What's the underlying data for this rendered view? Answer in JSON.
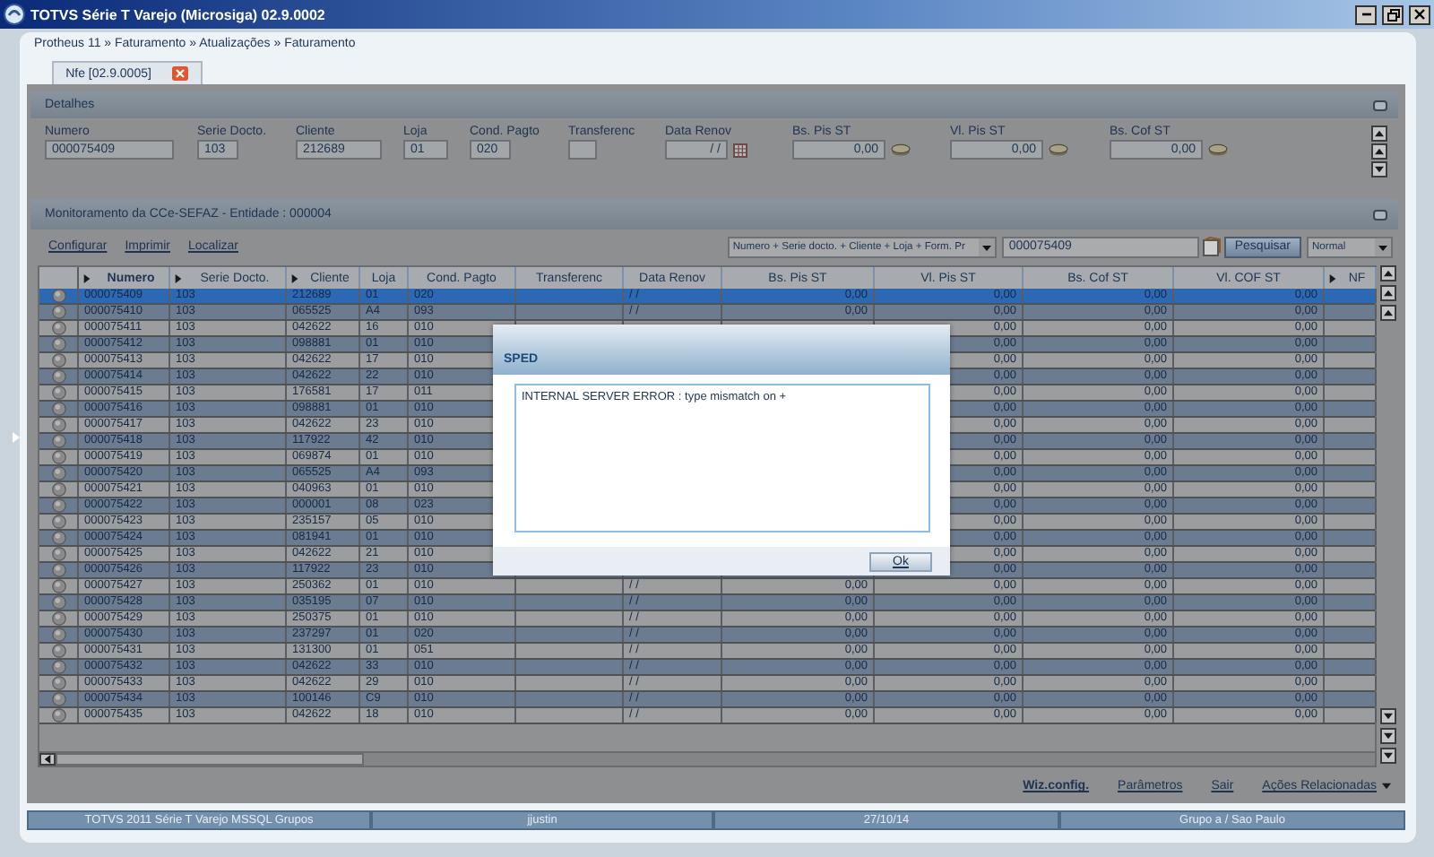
{
  "window": {
    "title": "TOTVS Série T Varejo (Microsiga) 02.9.0002"
  },
  "breadcrumb": "Protheus 11 » Faturamento » Atualizações » Faturamento",
  "tabs": [
    {
      "label": "Nfe [02.9.0005]",
      "selected": true
    }
  ],
  "details": {
    "title": "Detalhes",
    "fields": [
      {
        "label": "Numero",
        "value": "000075409",
        "kind": "text"
      },
      {
        "label": "Serie Docto.",
        "value": "103",
        "kind": "text"
      },
      {
        "label": "Cliente",
        "value": "212689",
        "kind": "text"
      },
      {
        "label": "Loja",
        "value": "01",
        "kind": "text"
      },
      {
        "label": "Cond. Pagto",
        "value": "020",
        "kind": "text"
      },
      {
        "label": "Transferenc",
        "kind": "text"
      },
      {
        "label": "Data Renov",
        "value": " / /",
        "kind": "date"
      },
      {
        "label": "Bs. Pis ST",
        "value": "0,00",
        "kind": "money"
      },
      {
        "label": "Vl. Pis ST",
        "value": "0,00",
        "kind": "money"
      },
      {
        "label": "Bs. Cof ST",
        "value": "0,00",
        "kind": "money"
      }
    ]
  },
  "monitor": {
    "title": "Monitoramento da CCe-SEFAZ - Entidade : 000004",
    "links": [
      "Configurar",
      "Imprimir",
      "Localizar"
    ],
    "order_select": "Numero + Serie docto. + Cliente + Loja + Form. Pr",
    "search_value": "000075409",
    "search_button": "Pesquisar",
    "mode_select": "Normal"
  },
  "table": {
    "columns": [
      {
        "label": "Numero",
        "arrow": true,
        "sorted": true
      },
      {
        "label": "Serie Docto.",
        "arrow": true,
        "sorted": false
      },
      {
        "label": "Cliente",
        "arrow": true,
        "sorted": false
      },
      {
        "label": "Loja",
        "arrow": false,
        "sorted": false
      },
      {
        "label": "Cond. Pagto",
        "arrow": false,
        "sorted": false
      },
      {
        "label": "Transferenc",
        "arrow": false,
        "sorted": false
      },
      {
        "label": "Data Renov",
        "arrow": false,
        "sorted": false
      },
      {
        "label": "Bs. Pis ST",
        "arrow": false,
        "sorted": false
      },
      {
        "label": "Vl. Pis ST",
        "arrow": false,
        "sorted": false
      },
      {
        "label": "Bs. Cof ST",
        "arrow": false,
        "sorted": false
      },
      {
        "label": "Vl. COF ST",
        "arrow": false,
        "sorted": false
      },
      {
        "label": "NF",
        "arrow": true,
        "sorted": false
      }
    ],
    "rows": [
      {
        "selected": true,
        "numero": "000075409",
        "serie": "103",
        "cliente": "212689",
        "loja": "01",
        "cond": "020",
        "data": "/ /",
        "bs_pis": "0,00",
        "vl_pis": "0,00",
        "bs_cof": "0,00",
        "vl_cof": "0,00"
      },
      {
        "selected": false,
        "numero": "000075410",
        "serie": "103",
        "cliente": "065525",
        "loja": "A4",
        "cond": "093",
        "data": "/ /",
        "bs_pis": "0,00",
        "vl_pis": "0,00",
        "bs_cof": "0,00",
        "vl_cof": "0,00"
      },
      {
        "selected": false,
        "numero": "000075411",
        "serie": "103",
        "cliente": "042622",
        "loja": "16",
        "cond": "010",
        "vl_pis": "0,00",
        "bs_cof": "0,00",
        "vl_cof": "0,00"
      },
      {
        "selected": false,
        "numero": "000075412",
        "serie": "103",
        "cliente": "098881",
        "loja": "01",
        "cond": "010",
        "vl_pis": "0,00",
        "bs_cof": "0,00",
        "vl_cof": "0,00"
      },
      {
        "selected": false,
        "numero": "000075413",
        "serie": "103",
        "cliente": "042622",
        "loja": "17",
        "cond": "010",
        "vl_pis": "0,00",
        "bs_cof": "0,00",
        "vl_cof": "0,00"
      },
      {
        "selected": false,
        "numero": "000075414",
        "serie": "103",
        "cliente": "042622",
        "loja": "22",
        "cond": "010",
        "vl_pis": "0,00",
        "bs_cof": "0,00",
        "vl_cof": "0,00"
      },
      {
        "selected": false,
        "numero": "000075415",
        "serie": "103",
        "cliente": "176581",
        "loja": "17",
        "cond": "011",
        "vl_pis": "0,00",
        "bs_cof": "0,00",
        "vl_cof": "0,00"
      },
      {
        "selected": false,
        "numero": "000075416",
        "serie": "103",
        "cliente": "098881",
        "loja": "01",
        "cond": "010",
        "vl_pis": "0,00",
        "bs_cof": "0,00",
        "vl_cof": "0,00"
      },
      {
        "selected": false,
        "numero": "000075417",
        "serie": "103",
        "cliente": "042622",
        "loja": "23",
        "cond": "010",
        "vl_pis": "0,00",
        "bs_cof": "0,00",
        "vl_cof": "0,00"
      },
      {
        "selected": false,
        "numero": "000075418",
        "serie": "103",
        "cliente": "117922",
        "loja": "42",
        "cond": "010",
        "vl_pis": "0,00",
        "bs_cof": "0,00",
        "vl_cof": "0,00"
      },
      {
        "selected": false,
        "numero": "000075419",
        "serie": "103",
        "cliente": "069874",
        "loja": "01",
        "cond": "010",
        "vl_pis": "0,00",
        "bs_cof": "0,00",
        "vl_cof": "0,00"
      },
      {
        "selected": false,
        "numero": "000075420",
        "serie": "103",
        "cliente": "065525",
        "loja": "A4",
        "cond": "093",
        "vl_pis": "0,00",
        "bs_cof": "0,00",
        "vl_cof": "0,00"
      },
      {
        "selected": false,
        "numero": "000075421",
        "serie": "103",
        "cliente": "040963",
        "loja": "01",
        "cond": "010",
        "vl_pis": "0,00",
        "bs_cof": "0,00",
        "vl_cof": "0,00"
      },
      {
        "selected": false,
        "numero": "000075422",
        "serie": "103",
        "cliente": "000001",
        "loja": "08",
        "cond": "023",
        "vl_pis": "0,00",
        "bs_cof": "0,00",
        "vl_cof": "0,00"
      },
      {
        "selected": false,
        "numero": "000075423",
        "serie": "103",
        "cliente": "235157",
        "loja": "05",
        "cond": "010",
        "vl_pis": "0,00",
        "bs_cof": "0,00",
        "vl_cof": "0,00"
      },
      {
        "selected": false,
        "numero": "000075424",
        "serie": "103",
        "cliente": "081941",
        "loja": "01",
        "cond": "010",
        "vl_pis": "0,00",
        "bs_cof": "0,00",
        "vl_cof": "0,00"
      },
      {
        "selected": false,
        "numero": "000075425",
        "serie": "103",
        "cliente": "042622",
        "loja": "21",
        "cond": "010",
        "vl_pis": "0,00",
        "bs_cof": "0,00",
        "vl_cof": "0,00"
      },
      {
        "selected": false,
        "numero": "000075426",
        "serie": "103",
        "cliente": "117922",
        "loja": "23",
        "cond": "010",
        "vl_pis": "0,00",
        "bs_cof": "0,00",
        "vl_cof": "0,00"
      },
      {
        "selected": false,
        "numero": "000075427",
        "serie": "103",
        "cliente": "250362",
        "loja": "01",
        "cond": "010",
        "data": "/ /",
        "bs_pis": "0,00",
        "vl_pis": "0,00",
        "bs_cof": "0,00",
        "vl_cof": "0,00"
      },
      {
        "selected": false,
        "numero": "000075428",
        "serie": "103",
        "cliente": "035195",
        "loja": "07",
        "cond": "010",
        "data": "/ /",
        "bs_pis": "0,00",
        "vl_pis": "0,00",
        "bs_cof": "0,00",
        "vl_cof": "0,00"
      },
      {
        "selected": false,
        "numero": "000075429",
        "serie": "103",
        "cliente": "250375",
        "loja": "01",
        "cond": "010",
        "data": "/ /",
        "bs_pis": "0,00",
        "vl_pis": "0,00",
        "bs_cof": "0,00",
        "vl_cof": "0,00"
      },
      {
        "selected": false,
        "numero": "000075430",
        "serie": "103",
        "cliente": "237297",
        "loja": "01",
        "cond": "020",
        "data": "/ /",
        "bs_pis": "0,00",
        "vl_pis": "0,00",
        "bs_cof": "0,00",
        "vl_cof": "0,00"
      },
      {
        "selected": false,
        "numero": "000075431",
        "serie": "103",
        "cliente": "131300",
        "loja": "01",
        "cond": "051",
        "data": "/ /",
        "bs_pis": "0,00",
        "vl_pis": "0,00",
        "bs_cof": "0,00",
        "vl_cof": "0,00"
      },
      {
        "selected": false,
        "numero": "000075432",
        "serie": "103",
        "cliente": "042622",
        "loja": "33",
        "cond": "010",
        "data": "/ /",
        "bs_pis": "0,00",
        "vl_pis": "0,00",
        "bs_cof": "0,00",
        "vl_cof": "0,00"
      },
      {
        "selected": false,
        "numero": "000075433",
        "serie": "103",
        "cliente": "042622",
        "loja": "29",
        "cond": "010",
        "data": "/ /",
        "bs_pis": "0,00",
        "vl_pis": "0,00",
        "bs_cof": "0,00",
        "vl_cof": "0,00"
      },
      {
        "selected": false,
        "numero": "000075434",
        "serie": "103",
        "cliente": "100146",
        "loja": "C9",
        "cond": "010",
        "data": "/ /",
        "bs_pis": "0,00",
        "vl_pis": "0,00",
        "bs_cof": "0,00",
        "vl_cof": "0,00"
      },
      {
        "selected": false,
        "numero": "000075435",
        "serie": "103",
        "cliente": "042622",
        "loja": "18",
        "cond": "010",
        "data": "/ /",
        "bs_pis": "0,00",
        "vl_pis": "0,00",
        "bs_cof": "0,00",
        "vl_cof": "0,00"
      }
    ]
  },
  "actions": [
    {
      "label": "Wiz.config.",
      "kind": "primary"
    },
    {
      "label": "Parâmetros",
      "kind": "link"
    },
    {
      "label": "Sair",
      "kind": "link"
    },
    {
      "label": "Ações Relacionadas",
      "kind": "menu"
    }
  ],
  "status_bar": [
    "TOTVS 2011 Série T Varejo MSSQL Grupos",
    "jjustin",
    "27/10/14",
    "Grupo a / Sao Paulo"
  ],
  "dialog": {
    "title": "SPED",
    "message": "INTERNAL SERVER ERROR : type mismatch on +",
    "button": "Ok"
  }
}
